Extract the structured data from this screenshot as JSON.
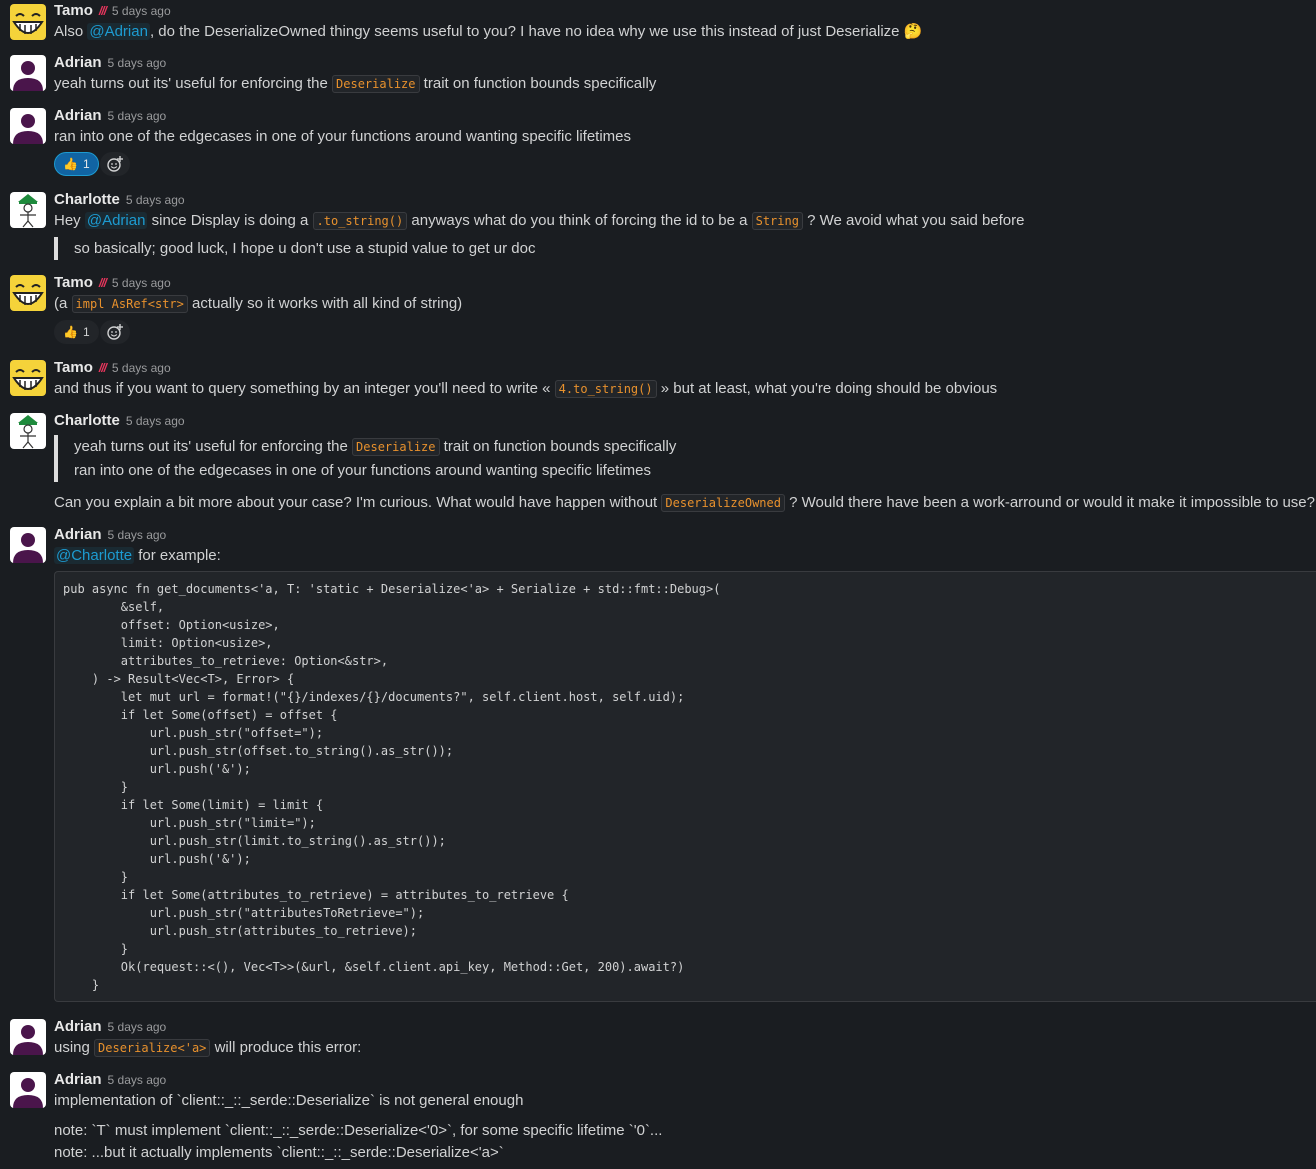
{
  "messages": [
    {
      "author": "Tamo",
      "badge": "///",
      "time": "5 days ago",
      "segments": [
        {
          "t": "text",
          "v": "Also "
        },
        {
          "t": "mention",
          "v": "@Adrian"
        },
        {
          "t": "text",
          "v": ", do the DeserializeOwned thingy seems useful to you? I have no idea why we use this instead of just Deserialize "
        },
        {
          "t": "text",
          "v": "🤔"
        }
      ]
    },
    {
      "author": "Adrian",
      "time": "5 days ago",
      "segments": [
        {
          "t": "text",
          "v": "yeah turns out its' useful for enforcing the "
        },
        {
          "t": "code",
          "v": "Deserialize"
        },
        {
          "t": "text",
          "v": " trait on function bounds specifically"
        }
      ]
    },
    {
      "author": "Adrian",
      "time": "5 days ago",
      "segments": [
        {
          "t": "text",
          "v": "ran into one of the edgecases in one of your functions around wanting specific lifetimes"
        }
      ],
      "reaction": {
        "emoji": "👍",
        "count": "1"
      }
    },
    {
      "author": "Charlotte",
      "time": "5 days ago",
      "segments": [
        {
          "t": "text",
          "v": "Hey "
        },
        {
          "t": "mention",
          "v": "@Adrian"
        },
        {
          "t": "text",
          "v": " since Display is doing a "
        },
        {
          "t": "code",
          "v": ".to_string()"
        },
        {
          "t": "text",
          "v": " anyways what do you think of forcing the id to be a "
        },
        {
          "t": "code",
          "v": "String"
        },
        {
          "t": "text",
          "v": " ? We avoid what you said before"
        }
      ],
      "quote": [
        "so basically; good luck, I hope u don't use a stupid value to get ur doc"
      ]
    },
    {
      "author": "Tamo",
      "badge": "///",
      "time": "5 days ago",
      "segments": [
        {
          "t": "text",
          "v": "(a "
        },
        {
          "t": "code",
          "v": "impl AsRef<str>"
        },
        {
          "t": "text",
          "v": " actually so it works with all kind of string)"
        }
      ],
      "reaction": {
        "emoji": "👍",
        "count": "1"
      }
    },
    {
      "author": "Tamo",
      "badge": "///",
      "time": "5 days ago",
      "segments": [
        {
          "t": "text",
          "v": "and thus if you want to query something by an integer you'll need to write « "
        },
        {
          "t": "code",
          "v": "4.to_string()"
        },
        {
          "t": "text",
          "v": "  » but at least, what you're doing should be obvious"
        }
      ]
    },
    {
      "author": "Charlotte",
      "time": "5 days ago",
      "quote_segments": [
        [
          {
            "t": "text",
            "v": "yeah turns out its' useful for enforcing the "
          },
          {
            "t": "code",
            "v": "Deserialize"
          },
          {
            "t": "text",
            "v": " trait on function bounds specifically"
          }
        ],
        [
          {
            "t": "text",
            "v": "ran into one of the edgecases in one of your functions around wanting specific lifetimes"
          }
        ]
      ],
      "segments": [
        {
          "t": "text",
          "v": "Can you explain a bit more about your case? I'm curious. What would have happen without "
        },
        {
          "t": "code",
          "v": "DeserializeOwned"
        },
        {
          "t": "text",
          "v": " ? Would there have been a work-arround or would it make it impossible to use?"
        }
      ]
    },
    {
      "author": "Adrian",
      "time": "5 days ago",
      "segments": [
        {
          "t": "mention",
          "v": "@Charlotte"
        },
        {
          "t": "text",
          "v": " for example:"
        }
      ],
      "code_block": [
        "pub async fn get_documents<'a, T: 'static + Deserialize<'a> + Serialize + std::fmt::Debug>(",
        "        &self,",
        "        offset: Option<usize>,",
        "        limit: Option<usize>,",
        "        attributes_to_retrieve: Option<&str>,",
        "    ) -> Result<Vec<T>, Error> {",
        "        let mut url = format!(\"{}/indexes/{}/documents?\", self.client.host, self.uid);",
        "        if let Some(offset) = offset {",
        "            url.push_str(\"offset=\");",
        "            url.push_str(offset.to_string().as_str());",
        "            url.push('&');",
        "        }",
        "        if let Some(limit) = limit {",
        "            url.push_str(\"limit=\");",
        "            url.push_str(limit.to_string().as_str());",
        "            url.push('&');",
        "        }",
        "        if let Some(attributes_to_retrieve) = attributes_to_retrieve {",
        "            url.push_str(\"attributesToRetrieve=\");",
        "            url.push_str(attributes_to_retrieve);",
        "        }",
        "        Ok(request::<(), Vec<T>>(&url, &self.client.api_key, Method::Get, 200).await?)",
        "    }"
      ]
    },
    {
      "author": "Adrian",
      "time": "5 days ago",
      "segments": [
        {
          "t": "text",
          "v": "using "
        },
        {
          "t": "code",
          "v": "Deserialize<'a>"
        },
        {
          "t": "text",
          "v": " will produce this error:"
        }
      ]
    },
    {
      "author": "Adrian",
      "time": "5 days ago",
      "segments": [
        {
          "t": "text",
          "v": "implementation of `client::_::_serde::Deserialize` is not general enough"
        }
      ],
      "extra_lines": [
        "note: `T` must implement `client::_::_serde::Deserialize<'0>`, for some specific lifetime `'0`...",
        "note: ...but it actually implements `client::_::_serde::Deserialize<'a>`"
      ]
    }
  ],
  "colors": {
    "background": "#1a1d21",
    "mention": "#1d9bd1",
    "inline_code": "#e8912d",
    "reaction_active": "#1164a3",
    "badge": "#e8365d"
  },
  "icons": {
    "tamo_avatar": "grinning-face-avatar",
    "adrian_avatar": "default-person-avatar",
    "charlotte_avatar": "green-hat-stickfigure-avatar",
    "add_reaction": "add-emoji-icon"
  }
}
